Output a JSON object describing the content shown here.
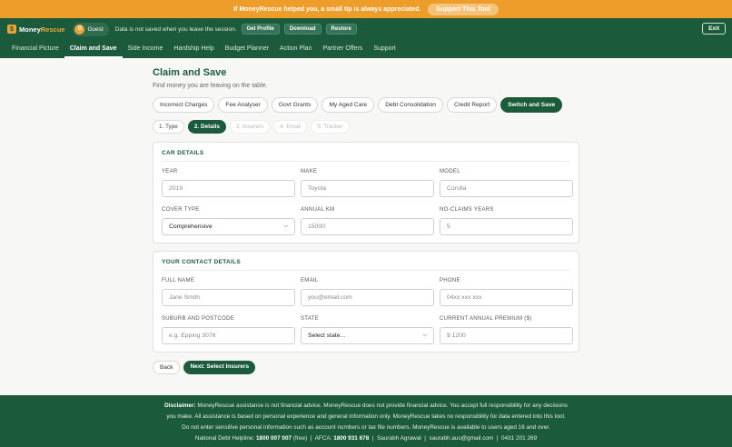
{
  "banner": {
    "text": "If MoneyRescue helped you, a small tip is always appreciated.",
    "button": "Support This Tool"
  },
  "topbar": {
    "logo_part1": "Money",
    "logo_part2": "Rescue",
    "logo_mark": "$",
    "guest_initial": "G",
    "guest_label": "Guest",
    "note": "Data is not saved when you leave the session.",
    "buttons": [
      "Get Profile",
      "Download",
      "Restore"
    ],
    "exit": "Exit"
  },
  "nav": {
    "items": [
      "Financial Picture",
      "Claim and Save",
      "Side Income",
      "Hardship Help",
      "Budget Planner",
      "Action Plan",
      "Partner Offers",
      "Support"
    ],
    "active": "Claim and Save"
  },
  "page": {
    "title": "Claim and Save",
    "subtitle": "Find money you are leaving on the table."
  },
  "tools": {
    "items": [
      "Incorrect Charges",
      "Fee Analyser",
      "Govt Grants",
      "My Aged Care",
      "Debt Consolidation",
      "Credit Report",
      "Switch and Save"
    ],
    "active": "Switch and Save"
  },
  "steps": {
    "items": [
      "1. Type",
      "2. Details",
      "3. Insurers",
      "4. Email",
      "5. Tracker"
    ],
    "active": "2. Details",
    "disabled": [
      "3. Insurers",
      "4. Email",
      "5. Tracker"
    ]
  },
  "car": {
    "title": "CAR DETAILS",
    "year_label": "YEAR",
    "year_placeholder": "2019",
    "make_label": "MAKE",
    "make_placeholder": "Toyota",
    "model_label": "MODEL",
    "model_placeholder": "Corolla",
    "cover_label": "COVER TYPE",
    "cover_value": "Comprehensive",
    "km_label": "ANNUAL KM",
    "km_placeholder": "15000",
    "ncy_label": "NO-CLAIMS YEARS",
    "ncy_placeholder": "5"
  },
  "contact": {
    "title": "YOUR CONTACT DETAILS",
    "name_label": "FULL NAME",
    "name_placeholder": "Jane Smith",
    "email_label": "EMAIL",
    "email_placeholder": "you@email.com",
    "phone_label": "PHONE",
    "phone_placeholder": "04xx xxx xxx",
    "suburb_label": "SUBURB AND POSTCODE",
    "suburb_placeholder": "e.g. Epping 3076",
    "state_label": "STATE",
    "state_value": "Select state...",
    "premium_label": "CURRENT ANNUAL PREMIUM ($)",
    "premium_placeholder": "$ 1200"
  },
  "actions": {
    "back": "Back",
    "next": "Next: Select Insurers"
  },
  "footer": {
    "disclaimer_label": "Disclaimer:",
    "line1": "MoneyRescue assistance is not financial advice. MoneyRescue does not provide financial advice. You accept full responsibility for any decisions",
    "line2": "you make. All assistance is based on personal experience and general information only. MoneyRescue takes no responsibility for data entered into this tool.",
    "line3": "Do not enter sensitive personal information such as account numbers or tax file numbers. MoneyRescue is available to users aged 16 and over.",
    "helpline_label": "National Debt Helpline:",
    "helpline": "1800 007 007",
    "free": "(free)",
    "afca_label": "AFCA:",
    "afca": "1800 931 678",
    "name": "Saurabh Agrawal",
    "email": "saurabh.aus@gmail.com",
    "phone": "0431 201 269"
  },
  "colors": {
    "brand_green": "#1c5a3c",
    "banner_orange": "#ee9d2a",
    "accent_orange": "#f2a93b"
  }
}
